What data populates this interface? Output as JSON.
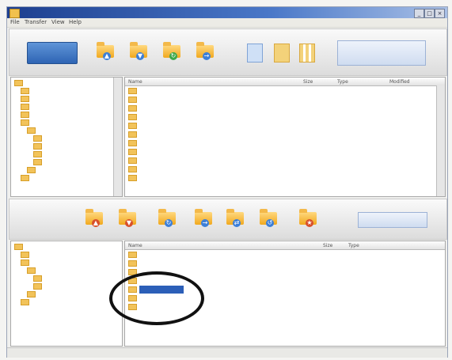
{
  "window": {
    "title": "",
    "controls": [
      "_",
      "□",
      "×"
    ]
  },
  "menu": [
    "File",
    "Transfer",
    "View",
    "Help"
  ],
  "top_toolbar": {
    "logo_label": "",
    "tools": [
      {
        "icon": "folder-upload-icon"
      },
      {
        "icon": "folder-download-icon"
      },
      {
        "icon": "folder-sync-icon"
      },
      {
        "icon": "folder-move-icon"
      },
      {
        "icon": "pages-icon"
      },
      {
        "icon": "copy-files-icon"
      },
      {
        "icon": "columns-icon"
      }
    ],
    "right_panel_label": ""
  },
  "top_tree": {
    "items": [
      "",
      "",
      "",
      "",
      "",
      "",
      "",
      "",
      "",
      "",
      "",
      "",
      ""
    ]
  },
  "top_list": {
    "columns": [
      "Name",
      "Size",
      "Type",
      "Modified"
    ],
    "rows": [
      {
        "name": "",
        "size": "",
        "type": "",
        "modified": ""
      },
      {
        "name": "",
        "size": "",
        "type": "",
        "modified": ""
      },
      {
        "name": "",
        "size": "",
        "type": "",
        "modified": ""
      },
      {
        "name": "",
        "size": "",
        "type": "",
        "modified": ""
      },
      {
        "name": "",
        "size": "",
        "type": "",
        "modified": ""
      },
      {
        "name": "",
        "size": "",
        "type": "",
        "modified": ""
      },
      {
        "name": "",
        "size": "",
        "type": "",
        "modified": ""
      },
      {
        "name": "",
        "size": "",
        "type": "",
        "modified": ""
      },
      {
        "name": "",
        "size": "",
        "type": "",
        "modified": ""
      },
      {
        "name": "",
        "size": "",
        "type": "",
        "modified": ""
      },
      {
        "name": "",
        "size": "",
        "type": "",
        "modified": ""
      }
    ]
  },
  "middle_toolbar": {
    "tools": [
      {
        "icon": "folder-upload-icon"
      },
      {
        "icon": "folder-download-icon"
      },
      {
        "icon": "folder-sync-icon"
      },
      {
        "icon": "folder-move-icon"
      },
      {
        "icon": "folder-copy-icon"
      },
      {
        "icon": "folder-refresh-icon"
      },
      {
        "icon": "folder-star-icon"
      }
    ],
    "right_label": ""
  },
  "bottom_tree": {
    "items": [
      "",
      "",
      "",
      "",
      "",
      "",
      "",
      ""
    ]
  },
  "bottom_list": {
    "columns": [
      "Name",
      "Size",
      "Type"
    ],
    "rows": [
      {
        "name": "",
        "size": "",
        "type": ""
      },
      {
        "name": "",
        "size": "",
        "type": ""
      },
      {
        "name": "",
        "size": "",
        "type": ""
      },
      {
        "name": "",
        "size": "",
        "type": ""
      },
      {
        "name": "",
        "size": "",
        "type": ""
      },
      {
        "name": "",
        "size": "",
        "type": ""
      },
      {
        "name": "",
        "size": "",
        "type": ""
      }
    ],
    "selected_index": 4
  },
  "status": {
    "left": "",
    "middle": "",
    "right": ""
  }
}
